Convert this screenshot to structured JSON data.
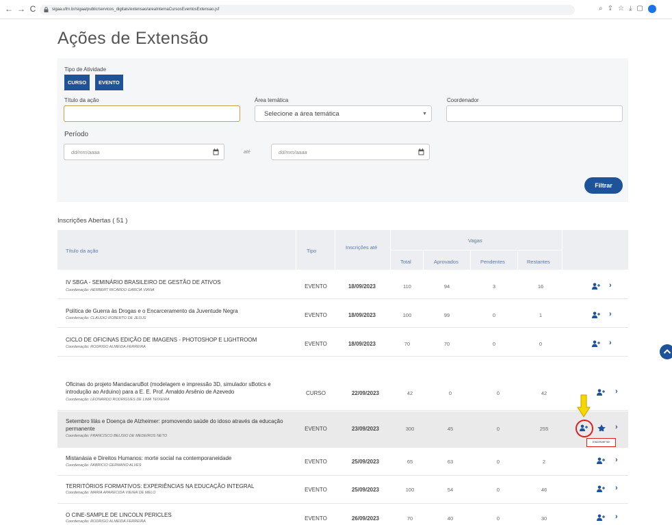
{
  "browser": {
    "back": "←",
    "forward": "→",
    "reload": "C",
    "url": "sigaa.ufrn.br/sigaa/public/servicos_digitais/extensao/areaInternaCursosEventosExtensao.jsf"
  },
  "page": {
    "title": "Ações de Extensão"
  },
  "filters": {
    "tipo_label": "Tipo de Atividade",
    "tipo_options": [
      "CURSO",
      "EVENTO"
    ],
    "titulo_label": "Título da ação",
    "titulo_value": "",
    "area_label": "Área temática",
    "area_placeholder": "Selecione a área temática",
    "coordenador_label": "Coordenador",
    "coordenador_value": "",
    "periodo_label": "Período",
    "date_placeholder": "dd/mm/aaaa",
    "ate_label": "até",
    "filtrar_label": "Filtrar"
  },
  "list": {
    "heading": "Inscrições Abertas ( 51 )"
  },
  "table": {
    "headers": {
      "titulo": "Título da ação",
      "tipo": "Tipo",
      "inscricoes": "Inscrições até",
      "vagas": "Vagas",
      "total": "Total",
      "aprovados": "Aprovados",
      "pendentes": "Pendentes",
      "restantes": "Restantes"
    },
    "rows": [
      {
        "title": "IV SBGA - SEMINÁRIO BRASILEIRO DE GESTÃO DE ATIVOS",
        "coord": "Coordenação: HERBERT RICARDO GARCIA VIANA",
        "tipo": "EVENTO",
        "date": "18/09/2023",
        "total": "110",
        "aprovados": "94",
        "pendentes": "3",
        "restantes": "16"
      },
      {
        "title": "Política de Guerra às Drogas e o Encarceramento da Juventude Negra",
        "coord": "Coordenação: CLAUDIO ROBERTO DE JESUS",
        "tipo": "EVENTO",
        "date": "18/09/2023",
        "total": "100",
        "aprovados": "99",
        "pendentes": "0",
        "restantes": "1"
      },
      {
        "title": "CICLO DE OFICINAS EDIÇÃO DE IMAGENS - PHOTOSHOP E LIGHTROOM",
        "coord": "Coordenação: RODRIGO ALMEIDA FERREIRA",
        "tipo": "EVENTO",
        "date": "18/09/2023",
        "total": "70",
        "aprovados": "70",
        "pendentes": "0",
        "restantes": "0"
      },
      {
        "title": "Oficinas do projeto MandacaruBot (modelagem e impressão 3D, simulador sBotics e introdução ao Arduino) para a E. E. Prof. Arnaldo Arsênio de Azevedo",
        "coord": "Coordenação: LEONARDO RODRIGUES DE LIMA TEIXEIRA",
        "tipo": "CURSO",
        "date": "22/09/2023",
        "total": "42",
        "aprovados": "0",
        "pendentes": "0",
        "restantes": "42"
      },
      {
        "title": "Setembro lilás e Doença de Alzheimer: promovendo saúde do idoso através da educação permanente",
        "coord": "Coordenação: FRANCISCO BELISIO DE MEDEIROS NETO",
        "tipo": "EVENTO",
        "date": "23/09/2023",
        "total": "300",
        "aprovados": "45",
        "pendentes": "0",
        "restantes": "255"
      },
      {
        "title": "Mistanásia e Direitos Humanos: morte social na contemporaneidade",
        "coord": "Coordenação: FABRICIO GERMANO ALVES",
        "tipo": "EVENTO",
        "date": "25/09/2023",
        "total": "65",
        "aprovados": "63",
        "pendentes": "0",
        "restantes": "2"
      },
      {
        "title": "TERRITÓRIOS FORMATIVOS: EXPERIÊNCIAS NA EDUCAÇÃO INTEGRAL",
        "coord": "Coordenação: MARIA APARECIDA VIEIRA DE MELO",
        "tipo": "EVENTO",
        "date": "25/09/2023",
        "total": "100",
        "aprovados": "54",
        "pendentes": "0",
        "restantes": "46"
      },
      {
        "title": "O CINE-SAMPLE DE LINCOLN PERICLES",
        "coord": "Coordenação: RODRIGO ALMEIDA FERREIRA",
        "tipo": "EVENTO",
        "date": "26/09/2023",
        "total": "70",
        "aprovados": "40",
        "pendentes": "0",
        "restantes": "30"
      }
    ],
    "tooltip": "Inscrever-se",
    "chevron": "›"
  },
  "colors": {
    "primary": "#1e5299",
    "annotation": "#e02020",
    "arrow": "#f5d800"
  }
}
